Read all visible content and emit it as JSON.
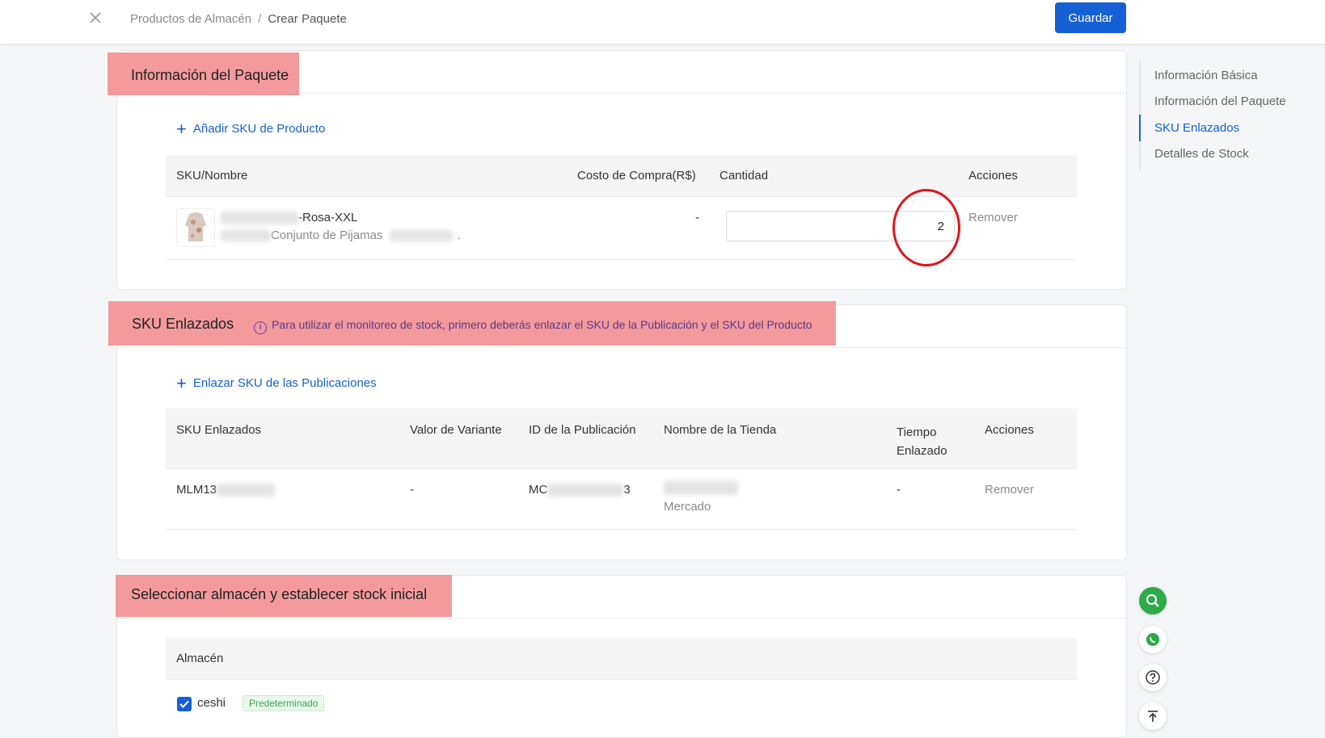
{
  "header": {
    "breadcrumb": [
      "Productos de Almacén",
      "Crear Paquete"
    ],
    "breadcrumb_sep": "/",
    "save_label": "Guardar"
  },
  "package": {
    "title": "Información del Paquete",
    "add_sku_label": "Añadir SKU de Producto",
    "columns": [
      "SKU/Nombre",
      "Costo de Compra(R$)",
      "Cantidad",
      "Acciones"
    ],
    "row": {
      "sku_suffix": "-Rosa-XXL",
      "name": "Conjunto de Pijamas",
      "name_trail": ".",
      "cost": "-",
      "quantity": "2",
      "action": "Remover"
    }
  },
  "linked": {
    "title": "SKU Enlazados",
    "hint": "Para utilizar el monitoreo de stock, primero deberás enlazar el SKU de la Publicación y el SKU del Producto",
    "link_label": "Enlazar SKU de las Publicaciones",
    "columns": [
      "SKU Enlazados",
      "Valor de Variante",
      "ID de la Publicación",
      "Nombre de la Tienda",
      "Tiempo Enlazado",
      "Acciones"
    ],
    "row": {
      "sku_prefix": "MLM13",
      "variant": "-",
      "pub_prefix": "MC",
      "pub_suffix": "3",
      "store": "Mercado",
      "time": "-",
      "action": "Remover"
    }
  },
  "warehouse": {
    "title": "Seleccionar almacén y establecer stock inicial",
    "column": "Almacén",
    "name": "ceshi",
    "badge": "Predeterminado"
  },
  "anchors": [
    "Información Básica",
    "Información del Paquete",
    "SKU Enlazados",
    "Detalles de Stock"
  ],
  "colors": {
    "accent": "#1660d6",
    "highlight": "#f39a9e",
    "annotation": "#e0151b",
    "green": "#36a853"
  }
}
